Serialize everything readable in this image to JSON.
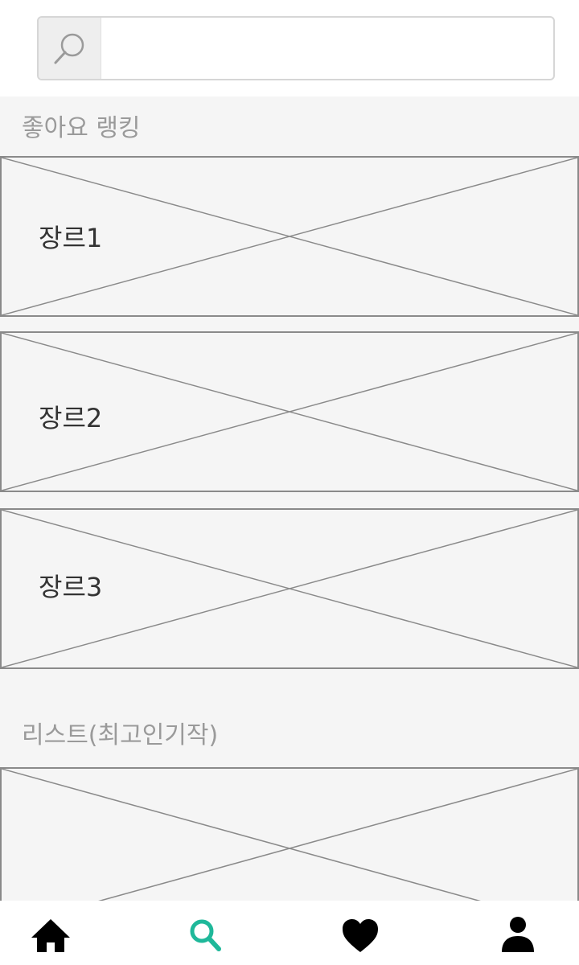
{
  "search": {
    "placeholder": "",
    "value": ""
  },
  "ranking_section": {
    "title": "좋아요 랭킹",
    "items": [
      {
        "label": "장르1"
      },
      {
        "label": "장르2"
      },
      {
        "label": "장르3"
      }
    ]
  },
  "list_section": {
    "title": "리스트(최고인기작)"
  },
  "bottom_nav": {
    "active": "search",
    "accent_color": "#1fb89a",
    "items": [
      {
        "icon": "home-icon"
      },
      {
        "icon": "search-icon"
      },
      {
        "icon": "heart-icon"
      },
      {
        "icon": "user-icon"
      }
    ]
  }
}
